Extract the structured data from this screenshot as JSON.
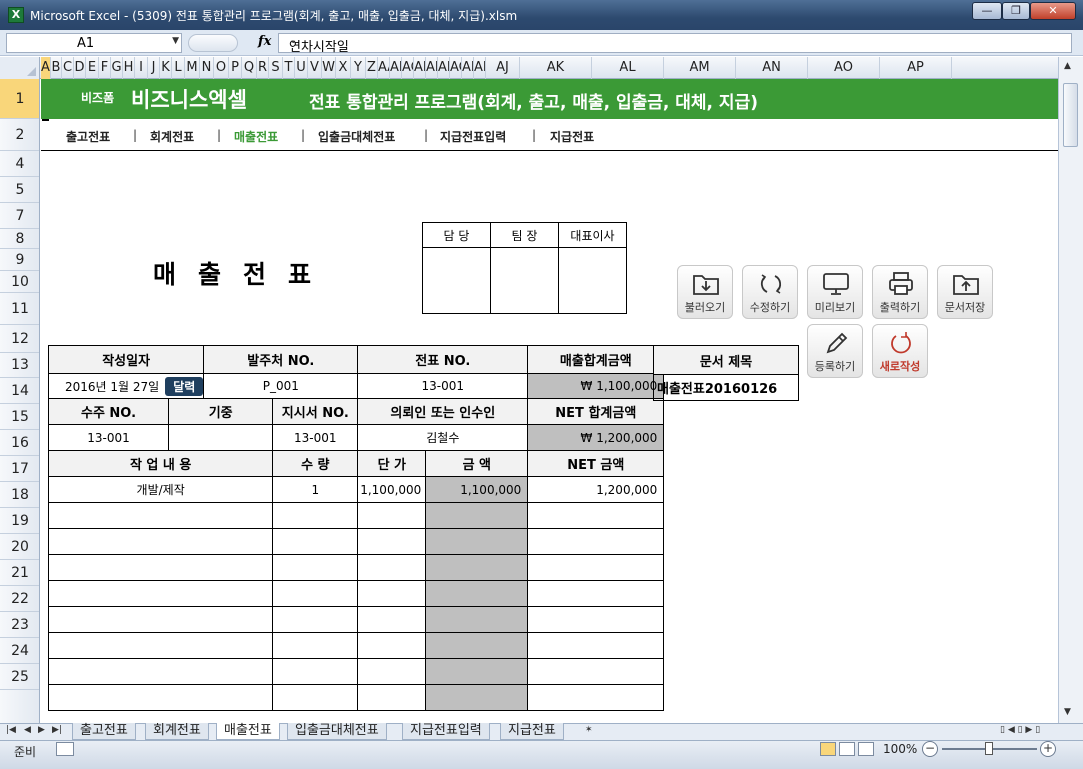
{
  "window": {
    "title": "Microsoft Excel - (5309) 전표 통합관리 프로그램(회계, 출고, 매출, 입출금, 대체, 지급).xlsm",
    "minimize": "—",
    "maximize": "❐",
    "close": "✕"
  },
  "formula_bar": {
    "name_box": "A1",
    "fx": "fx",
    "content": "연차시작일"
  },
  "columns": [
    "A",
    "B",
    "C",
    "D",
    "E",
    "F",
    "G",
    "H",
    "I",
    "J",
    "K",
    "L",
    "M",
    "N",
    "O",
    "P",
    "Q",
    "R",
    "S",
    "T",
    "U",
    "V",
    "W",
    "X",
    "Y",
    "Z",
    "AA",
    "AB",
    "AC",
    "AD",
    "AE",
    "AF",
    "AG",
    "AH",
    "AI",
    "AJ",
    "AK",
    "AL",
    "AM",
    "AN",
    "AO",
    "AP"
  ],
  "rows": [
    "1",
    "2",
    "4",
    "5",
    "7",
    "8",
    "9",
    "10",
    "11",
    "12",
    "13",
    "14",
    "15",
    "16",
    "17",
    "18",
    "19",
    "20",
    "21",
    "22",
    "23",
    "24",
    "25"
  ],
  "banner": {
    "brand_small": "비즈폼",
    "brand": "비즈니스엑셀",
    "title": "전표 통합관리 프로그램(회계, 출고, 매출, 입출금, 대체, 지급)"
  },
  "nav": {
    "items": [
      "출고전표",
      "회계전표",
      "매출전표",
      "입출금대체전표",
      "지급전표입력",
      "지급전표"
    ],
    "separator": "|",
    "active_index": 2
  },
  "doc_title": "매출전표",
  "approval": {
    "headers": [
      "담 당",
      "팀 장",
      "대표이사"
    ]
  },
  "buttons": {
    "load": "불러오기",
    "edit": "수정하기",
    "preview": "미리보기",
    "print": "출력하기",
    "save_doc": "문서저장",
    "register": "등록하기",
    "new": "새로작성"
  },
  "form": {
    "h_date": "작성일자",
    "h_order_no": "발주처 NO.",
    "h_slip_no": "전표 NO.",
    "h_total": "매출합계금액",
    "date": "2016년 1월 27일",
    "calendar_btn": "달력",
    "order_no": "P_001",
    "slip_no": "13-001",
    "total": "₩  1,100,000",
    "h_receive_no": "수주 NO.",
    "h_standard": "기중",
    "h_instruction_no": "지시서 NO.",
    "h_requester": "의뢰인 또는 인수인",
    "h_net_total": "NET 합계금액",
    "receive_no": "13-001",
    "standard": "",
    "instruction_no": "13-001",
    "requester": "김철수",
    "net_total": "₩  1,200,000",
    "h_work": "작 업 내 용",
    "h_qty": "수 량",
    "h_price": "단 가",
    "h_amount": "금    액",
    "h_net": "NET 금액",
    "lines": [
      {
        "work": "개발/제작",
        "qty": "1",
        "price": "1,100,000",
        "amount": "1,100,000",
        "net": "1,200,000"
      },
      {
        "work": "",
        "qty": "",
        "price": "",
        "amount": "",
        "net": ""
      },
      {
        "work": "",
        "qty": "",
        "price": "",
        "amount": "",
        "net": ""
      },
      {
        "work": "",
        "qty": "",
        "price": "",
        "amount": "",
        "net": ""
      },
      {
        "work": "",
        "qty": "",
        "price": "",
        "amount": "",
        "net": ""
      },
      {
        "work": "",
        "qty": "",
        "price": "",
        "amount": "",
        "net": ""
      },
      {
        "work": "",
        "qty": "",
        "price": "",
        "amount": "",
        "net": ""
      },
      {
        "work": "",
        "qty": "",
        "price": "",
        "amount": "",
        "net": ""
      },
      {
        "work": "",
        "qty": "",
        "price": "",
        "amount": "",
        "net": ""
      }
    ]
  },
  "doc_info": {
    "h_title": "문서 제목",
    "title": "매출전표20160126"
  },
  "sheet_tabs": [
    "출고전표",
    "회계전표",
    "매출전표",
    "입출금대체전표",
    "지급전표입력",
    "지급전표"
  ],
  "active_sheet": 2,
  "status": {
    "ready": "준비",
    "zoom": "100%"
  }
}
